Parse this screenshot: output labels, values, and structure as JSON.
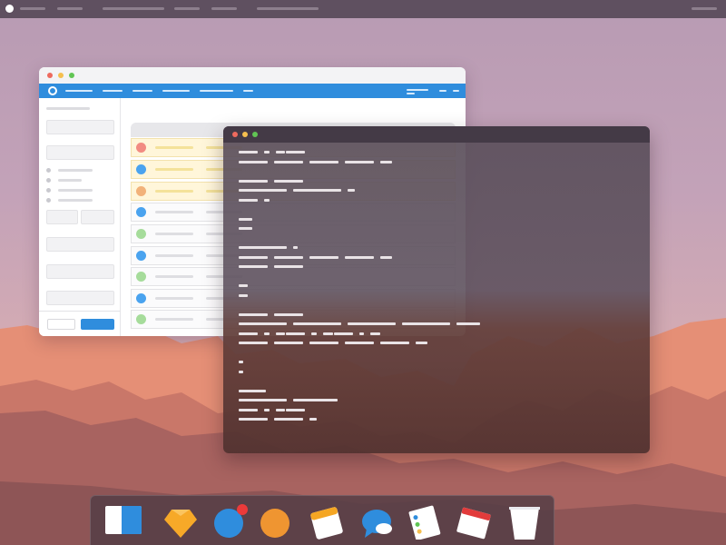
{
  "menubar": {
    "apple_icon": "apple-icon",
    "items_count_hint": "",
    "right_item": ""
  },
  "browser": {
    "title": "",
    "traffic_lights": [
      "#ed6a5e",
      "#f5bf4f",
      "#61c554"
    ],
    "accent": "#2f8ddd",
    "rows": [
      {
        "dot": "#f28b82",
        "highlight": true
      },
      {
        "dot": "#4aa3ef",
        "highlight": true
      },
      {
        "dot": "#f2b27a",
        "highlight": true
      },
      {
        "dot": "#4aa3ef",
        "highlight": false
      },
      {
        "dot": "#a6dc9b",
        "highlight": false
      },
      {
        "dot": "#4aa3ef",
        "highlight": false
      },
      {
        "dot": "#a6dc9b",
        "highlight": false
      },
      {
        "dot": "#4aa3ef",
        "highlight": false
      },
      {
        "dot": "#a6dc9b",
        "highlight": false
      },
      {
        "dot": "#a6dc9b",
        "highlight": false
      }
    ]
  },
  "terminal": {
    "title": "",
    "traffic_lights": [
      "#ed6a5e",
      "#f5bf4f",
      "#61c554"
    ],
    "lines": [
      [
        [
          31
        ],
        [
          8
        ],
        [
          16,
          31
        ]
      ],
      [
        [
          47
        ],
        [
          47
        ],
        [
          47
        ],
        [
          47
        ],
        [
          19
        ]
      ],
      [],
      [
        [
          47
        ],
        [
          47
        ]
      ],
      [
        [
          78
        ],
        [
          78
        ],
        [
          11
        ]
      ],
      [
        [
          31
        ],
        [
          8
        ]
      ],
      [],
      [
        [
          22
        ]
      ],
      [
        [
          22
        ]
      ],
      [],
      [
        [
          78
        ],
        [
          8
        ]
      ],
      [
        [
          47
        ],
        [
          47
        ],
        [
          47
        ],
        [
          47
        ],
        [
          19
        ]
      ],
      [
        [
          47
        ],
        [
          47
        ]
      ],
      [],
      [
        [
          14
        ]
      ],
      [
        [
          14
        ]
      ],
      [],
      [
        [
          47
        ],
        [
          47
        ]
      ],
      [
        [
          78
        ],
        [
          78
        ],
        [
          78
        ],
        [
          78
        ],
        [
          38
        ]
      ],
      [
        [
          31
        ],
        [
          8
        ],
        [
          16,
          31
        ],
        [
          8
        ],
        [
          16,
          31
        ],
        [
          8
        ],
        [
          16
        ]
      ],
      [
        [
          47
        ],
        [
          47
        ],
        [
          47
        ],
        [
          47
        ],
        [
          47
        ],
        [
          19
        ]
      ],
      [],
      [
        [
          8
        ]
      ],
      [
        [
          8
        ]
      ],
      [],
      [
        [
          44
        ]
      ],
      [
        [
          78
        ],
        [
          72
        ]
      ],
      [
        [
          31
        ],
        [
          8
        ],
        [
          16,
          31
        ]
      ],
      [
        [
          47
        ],
        [
          47
        ],
        [
          12
        ]
      ]
    ]
  },
  "dock": {
    "items": [
      {
        "name": "finder-icon"
      },
      {
        "name": "sketch-icon"
      },
      {
        "name": "mail-icon",
        "badge": true
      },
      {
        "name": "firefox-icon"
      },
      {
        "name": "notes-icon"
      },
      {
        "name": "messages-icon"
      },
      {
        "name": "reminders-icon"
      },
      {
        "name": "calendar-icon"
      },
      {
        "name": "trash-icon"
      }
    ]
  }
}
